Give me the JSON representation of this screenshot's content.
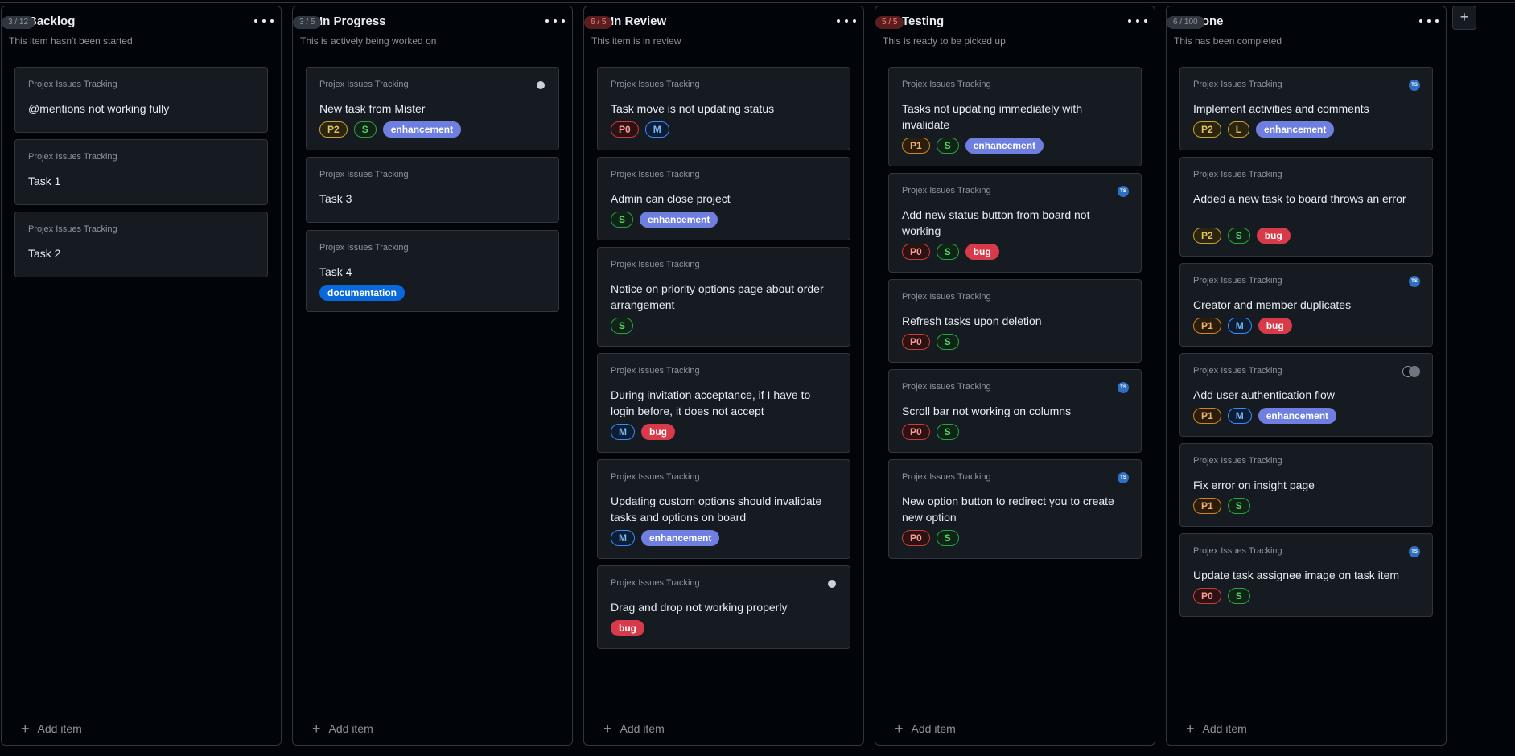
{
  "board": {
    "add_column_label": "+",
    "add_item_label": "Add item"
  },
  "columns": [
    {
      "title": "Backlog",
      "count": "3 / 12",
      "description": "This item hasn't been started",
      "status_color": "#3fb950",
      "cards": [
        {
          "project": "Projex Issues Tracking",
          "title": "@mentions not working fully",
          "tags": []
        },
        {
          "project": "Projex Issues Tracking",
          "title": "Task 1",
          "tags": []
        },
        {
          "project": "Projex Issues Tracking",
          "title": "Task 2",
          "tags": []
        }
      ]
    },
    {
      "title": "In Progress",
      "count": "3 / 5",
      "description": "This is actively being worked on",
      "status_color": "#388bfd",
      "cards": [
        {
          "project": "Projex Issues Tracking",
          "title": "New task from Mister",
          "tags": [
            "P2",
            "S",
            "enhancement"
          ],
          "avatar": "dark"
        },
        {
          "project": "Projex Issues Tracking",
          "title": "Task 3",
          "tags": []
        },
        {
          "project": "Projex Issues Tracking",
          "title": "Task 4",
          "tags": [
            "documentation"
          ]
        }
      ]
    },
    {
      "title": "In Review",
      "count": "6 / 5",
      "description": "This item is in review",
      "status_color": "#a371f7",
      "cards": [
        {
          "project": "Projex Issues Tracking",
          "title": "Task move is not updating status",
          "tags": [
            "P0",
            "M"
          ]
        },
        {
          "project": "Projex Issues Tracking",
          "title": "Admin can close project",
          "tags": [
            "S",
            "enhancement"
          ]
        },
        {
          "project": "Projex Issues Tracking",
          "title": "Notice on priority options page about order arrangement",
          "tags": [
            "S"
          ]
        },
        {
          "project": "Projex Issues Tracking",
          "title": "During invitation acceptance, if I have to login before, it does not accept",
          "tags": [
            "M",
            "bug"
          ]
        },
        {
          "project": "Projex Issues Tracking",
          "title": "Updating custom options should invalidate tasks and options on board",
          "tags": [
            "M",
            "enhancement"
          ]
        },
        {
          "project": "Projex Issues Tracking",
          "title": "Drag and drop not working properly",
          "tags": [
            "bug"
          ],
          "avatar": "dark"
        }
      ]
    },
    {
      "title": "Testing",
      "count": "5 / 5",
      "description": "This is ready to be picked up",
      "status_color": "#d29922",
      "cards": [
        {
          "project": "Projex Issues Tracking",
          "title": "Tasks not updating immediately with invalidate",
          "tags": [
            "P1",
            "S",
            "enhancement"
          ]
        },
        {
          "project": "Projex Issues Tracking",
          "title": "Add new status button from board not working",
          "tags": [
            "P0",
            "S",
            "bug"
          ],
          "avatar": "TS"
        },
        {
          "project": "Projex Issues Tracking",
          "title": "Refresh tasks upon deletion",
          "tags": [
            "P0",
            "S"
          ]
        },
        {
          "project": "Projex Issues Tracking",
          "title": "Scroll bar not working on columns",
          "tags": [
            "P0",
            "S"
          ],
          "avatar": "TS"
        },
        {
          "project": "Projex Issues Tracking",
          "title": "New option button to redirect you to create new option",
          "tags": [
            "P0",
            "S"
          ],
          "avatar": "TS"
        }
      ]
    },
    {
      "title": "Done",
      "count": "6 / 100",
      "description": "This has been completed",
      "status_color": "#f0883e",
      "cards": [
        {
          "project": "Projex Issues Tracking",
          "title": "Implement activities and comments",
          "tags": [
            "P2",
            "L",
            "enhancement"
          ],
          "avatar": "TS"
        },
        {
          "project": "Projex Issues Tracking",
          "title": "Added a new task to board throws an error",
          "tags": [
            "P2",
            "S",
            "bug"
          ]
        },
        {
          "project": "Projex Issues Tracking",
          "title": "Creator and member duplicates",
          "tags": [
            "P1",
            "M",
            "bug"
          ],
          "avatar": "TS"
        },
        {
          "project": "Projex Issues Tracking",
          "title": "Add user authentication flow",
          "tags": [
            "P1",
            "M",
            "enhancement"
          ],
          "avatar": "pair"
        },
        {
          "project": "Projex Issues Tracking",
          "title": "Fix error on insight page",
          "tags": [
            "P1",
            "S"
          ]
        },
        {
          "project": "Projex Issues Tracking",
          "title": "Update task assignee image on task item",
          "tags": [
            "P0",
            "S"
          ],
          "avatar": "TS"
        }
      ]
    }
  ]
}
